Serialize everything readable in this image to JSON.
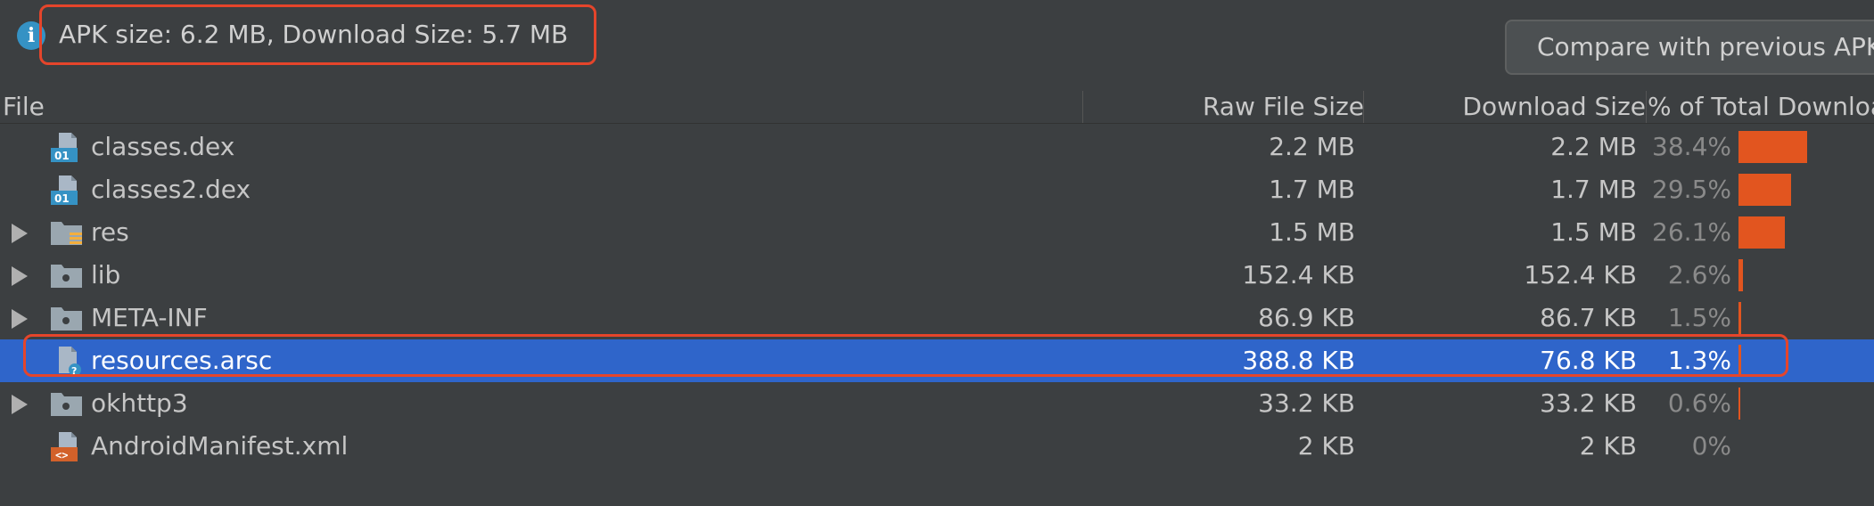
{
  "summary": {
    "info_icon": "info-icon",
    "text": "APK size: 6.2 MB, Download Size: 5.7 MB"
  },
  "compare_button": {
    "label": "Compare with previous APK..."
  },
  "table": {
    "columns": {
      "file": "File",
      "raw": "Raw File Size",
      "download": "Download Size",
      "percent": "% of Total Download Size"
    },
    "rows": [
      {
        "name": "classes.dex",
        "icon": "dex-file-icon",
        "expandable": false,
        "raw": "2.2 MB",
        "download": "2.2 MB",
        "percent": "38.4%",
        "share": 0.384,
        "selected": false
      },
      {
        "name": "classes2.dex",
        "icon": "dex-file-icon",
        "expandable": false,
        "raw": "1.7 MB",
        "download": "1.7 MB",
        "percent": "29.5%",
        "share": 0.295,
        "selected": false
      },
      {
        "name": "res",
        "icon": "resource-folder-icon",
        "expandable": true,
        "raw": "1.5 MB",
        "download": "1.5 MB",
        "percent": "26.1%",
        "share": 0.261,
        "selected": false
      },
      {
        "name": "lib",
        "icon": "folder-icon",
        "expandable": true,
        "raw": "152.4 KB",
        "download": "152.4 KB",
        "percent": "2.6%",
        "share": 0.026,
        "selected": false
      },
      {
        "name": "META-INF",
        "icon": "folder-icon",
        "expandable": true,
        "raw": "86.9 KB",
        "download": "86.7 KB",
        "percent": "1.5%",
        "share": 0.015,
        "selected": false
      },
      {
        "name": "resources.arsc",
        "icon": "arsc-file-icon",
        "expandable": false,
        "raw": "388.8 KB",
        "download": "76.8 KB",
        "percent": "1.3%",
        "share": 0.013,
        "selected": true
      },
      {
        "name": "okhttp3",
        "icon": "folder-icon",
        "expandable": true,
        "raw": "33.2 KB",
        "download": "33.2 KB",
        "percent": "0.6%",
        "share": 0.006,
        "selected": false
      },
      {
        "name": "AndroidManifest.xml",
        "icon": "xml-file-icon",
        "expandable": false,
        "raw": "2 KB",
        "download": "2 KB",
        "percent": "0%",
        "share": 0.0,
        "selected": false
      }
    ]
  },
  "colors": {
    "background": "#3c3f41",
    "selection": "#2f65ca",
    "bar": "#e2551f",
    "highlight": "#e5452b"
  }
}
